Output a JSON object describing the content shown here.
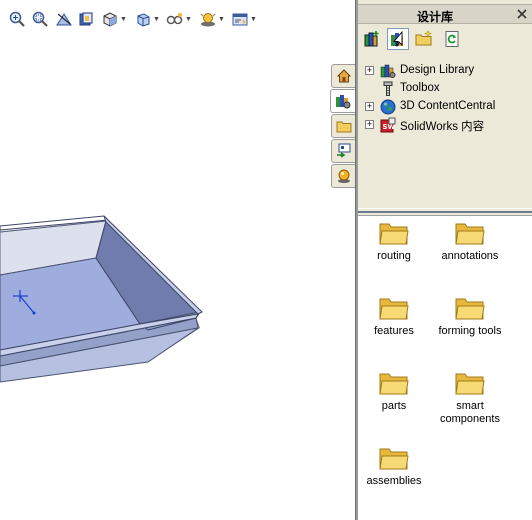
{
  "taskpane": {
    "title": "设计库",
    "tabs": [
      "home-icon",
      "design-library-icon",
      "file-explorer-icon",
      "view-palette-icon",
      "appearances-icon"
    ],
    "toolbar": [
      "add-to-library-icon",
      "add-file-location-icon",
      "create-new-folder-icon",
      "refresh-icon"
    ],
    "tree": [
      {
        "label": "Design Library",
        "expandable": true
      },
      {
        "label": "Toolbox",
        "expandable": false
      },
      {
        "label": "3D ContentCentral",
        "expandable": true
      },
      {
        "label": "SolidWorks 内容",
        "expandable": true
      }
    ],
    "folders": [
      {
        "label": "routing"
      },
      {
        "label": "annotations"
      },
      {
        "label": "features"
      },
      {
        "label": "forming tools"
      },
      {
        "label": "parts"
      },
      {
        "label": "smart components"
      },
      {
        "label": "assemblies"
      }
    ]
  },
  "view_toolbar": [
    "zoom-to-fit-icon",
    "zoom-to-area-icon",
    "section-view-icon",
    "display-style-icon",
    "view-orientation-icon",
    "hide-show-icon",
    "edit-appearance-icon",
    "apply-scene-icon",
    "view-settings-icon"
  ],
  "colors": {
    "panel": "#ece9d8",
    "folder": "#f3cf62",
    "part": "#a8b4dc"
  }
}
